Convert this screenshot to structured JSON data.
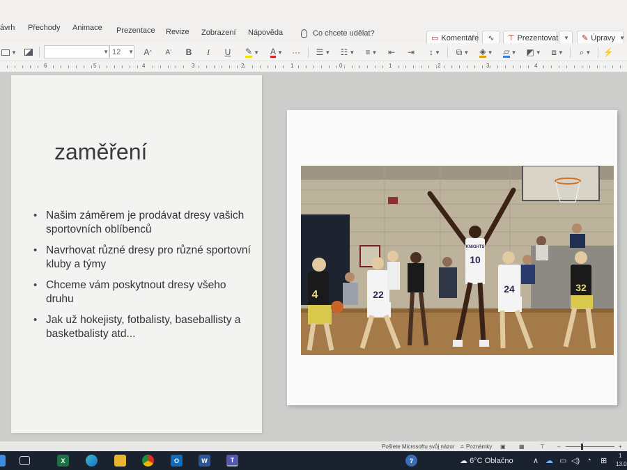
{
  "menu": {
    "items": [
      "ávrh",
      "Přechody",
      "Animace",
      "Prezentace",
      "Revize",
      "Zobrazení",
      "Nápověda"
    ],
    "tell_me": "Co chcete udělat?",
    "comments_label": "Komentáře",
    "present_label": "Prezentovat",
    "edit_label": "Úpravy"
  },
  "toolbar": {
    "font_size": "12",
    "bold": "B",
    "italic": "I",
    "underline": "U",
    "grow_font": "A",
    "shrink_font": "A",
    "font_color": "A",
    "more": "···"
  },
  "ruler": {
    "numbers": [
      "6",
      "5",
      "4",
      "3",
      "2",
      "1",
      "0",
      "1",
      "2",
      "3",
      "4"
    ]
  },
  "slide": {
    "title": "zaměření",
    "bullets": [
      "Našim záměrem je prodávat dresy vašich sportovních oblíbenců",
      "Navrhovat různé dresy pro různé sportovní kluby a týmy",
      "Chceme vám poskytnout dresy všeho druhu",
      "Jak už hokejisty, fotbalisty, baseballisty a basketbalisty atd..."
    ]
  },
  "photo": {
    "jersey_numbers": [
      "4",
      "22",
      "10",
      "24",
      "32"
    ],
    "team_text": "KNIGHTS"
  },
  "statusbar": {
    "feedback": "Pošlete Microsoftu svůj názor",
    "notes": "Poznámky"
  },
  "taskbar": {
    "temperature": "6°C",
    "weather": "Oblačno",
    "time": "1",
    "date": "13.0"
  },
  "colors": {
    "taskbar": "#1a2230",
    "accent": "#b3261e",
    "excel": "#1e7145",
    "word": "#2b579a",
    "outlook": "#0f6cbd",
    "teams": "#5558af"
  }
}
